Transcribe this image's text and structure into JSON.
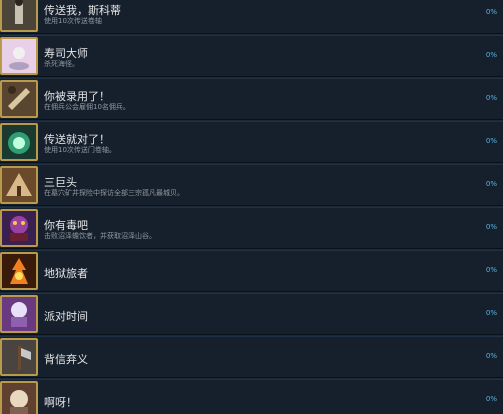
{
  "achievements": [
    {
      "title": "传送我，斯科蒂",
      "desc": "使用10次传送卷轴",
      "pct": "0%",
      "icon": "teleport-figure-icon",
      "colors": [
        "#4a4538",
        "#c8c0b0"
      ]
    },
    {
      "title": "寿司大师",
      "desc": "杀死海怪。",
      "pct": "0%",
      "icon": "sushi-master-icon",
      "colors": [
        "#e8d0e8",
        "#f0f0f0"
      ]
    },
    {
      "title": "你被录用了！",
      "desc": "在佣兵公会雇佣10名佣兵。",
      "pct": "0%",
      "icon": "hired-scroll-icon",
      "colors": [
        "#5a4530",
        "#d8c8a0"
      ]
    },
    {
      "title": "传送就对了！",
      "desc": "使用10次传送门卷轴。",
      "pct": "0%",
      "icon": "portal-icon",
      "colors": [
        "#1a3a30",
        "#40e0a0"
      ]
    },
    {
      "title": "三巨头",
      "desc": "在墓穴矿井探险中探访全部三宗孤凡最城贝。",
      "pct": "0%",
      "icon": "tent-icon",
      "colors": [
        "#6a4a2a",
        "#d8b888"
      ]
    },
    {
      "title": "你有毒吧",
      "desc": "击败沼泽蟾饮者，并获取沼泽山谷。",
      "pct": "0%",
      "icon": "poison-creature-icon",
      "colors": [
        "#3a2050",
        "#9a40a0"
      ]
    },
    {
      "title": "地狱旅者",
      "desc": "",
      "pct": "0%",
      "icon": "hell-fire-icon",
      "colors": [
        "#3a1a08",
        "#f08020"
      ]
    },
    {
      "title": "派对时间",
      "desc": "",
      "pct": "0%",
      "icon": "party-icon",
      "colors": [
        "#6a3a80",
        "#e8e0f8"
      ]
    },
    {
      "title": "背信弃义",
      "desc": "",
      "pct": "0%",
      "icon": "betrayal-axe-icon",
      "colors": [
        "#4a4440",
        "#c8c8c8"
      ]
    },
    {
      "title": "啊呀！",
      "desc": "",
      "pct": "0%",
      "icon": "oops-icon",
      "colors": [
        "#604030",
        "#e8d8c0"
      ]
    }
  ]
}
